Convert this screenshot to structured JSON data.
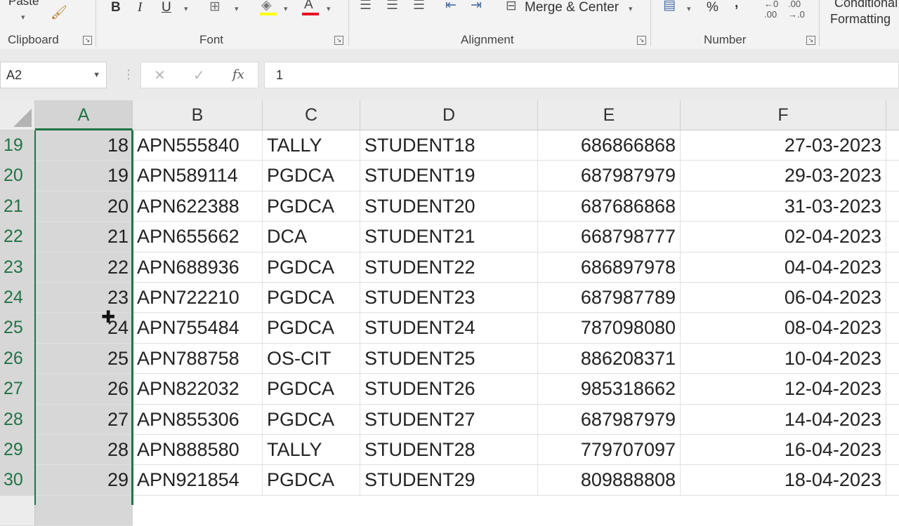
{
  "ribbon": {
    "paste_label": "Paste",
    "merge_center_label": "Merge & Center",
    "conditional_label": "Conditional",
    "formatting_label": "Formatting",
    "bold": "B",
    "italic": "I",
    "underline": "U",
    "percent": "%",
    "comma": ",",
    "groups": {
      "clipboard": "Clipboard",
      "font": "Font",
      "alignment": "Alignment",
      "number": "Number"
    }
  },
  "formula_bar": {
    "name_box": "A2",
    "formula": "1"
  },
  "colors": {
    "accent_green": "#217346",
    "font_color_red": "#e81123",
    "fill_yellow": "#ffff00"
  },
  "columns": [
    "A",
    "B",
    "C",
    "D",
    "E",
    "F"
  ],
  "rows": [
    {
      "num": "19",
      "a": "18",
      "b": "APN555840",
      "c": "TALLY",
      "d": "STUDENT18",
      "e": "686866868",
      "f": "27-03-2023"
    },
    {
      "num": "20",
      "a": "19",
      "b": "APN589114",
      "c": "PGDCA",
      "d": "STUDENT19",
      "e": "687987979",
      "f": "29-03-2023"
    },
    {
      "num": "21",
      "a": "20",
      "b": "APN622388",
      "c": "PGDCA",
      "d": "STUDENT20",
      "e": "687686868",
      "f": "31-03-2023"
    },
    {
      "num": "22",
      "a": "21",
      "b": "APN655662",
      "c": "DCA",
      "d": "STUDENT21",
      "e": "668798777",
      "f": "02-04-2023"
    },
    {
      "num": "23",
      "a": "22",
      "b": "APN688936",
      "c": "PGDCA",
      "d": "STUDENT22",
      "e": "686897978",
      "f": "04-04-2023"
    },
    {
      "num": "24",
      "a": "23",
      "b": "APN722210",
      "c": "PGDCA",
      "d": "STUDENT23",
      "e": "687987789",
      "f": "06-04-2023"
    },
    {
      "num": "25",
      "a": "24",
      "b": "APN755484",
      "c": "PGDCA",
      "d": "STUDENT24",
      "e": "787098080",
      "f": "08-04-2023"
    },
    {
      "num": "26",
      "a": "25",
      "b": "APN788758",
      "c": "OS-CIT",
      "d": "STUDENT25",
      "e": "886208371",
      "f": "10-04-2023"
    },
    {
      "num": "27",
      "a": "26",
      "b": "APN822032",
      "c": "PGDCA",
      "d": "STUDENT26",
      "e": "985318662",
      "f": "12-04-2023"
    },
    {
      "num": "28",
      "a": "27",
      "b": "APN855306",
      "c": "PGDCA",
      "d": "STUDENT27",
      "e": "687987979",
      "f": "14-04-2023"
    },
    {
      "num": "29",
      "a": "28",
      "b": "APN888580",
      "c": "TALLY",
      "d": "STUDENT28",
      "e": "779707097",
      "f": "16-04-2023"
    },
    {
      "num": "30",
      "a": "29",
      "b": "APN921854",
      "c": "PGDCA",
      "d": "STUDENT29",
      "e": "809888808",
      "f": "18-04-2023"
    }
  ]
}
